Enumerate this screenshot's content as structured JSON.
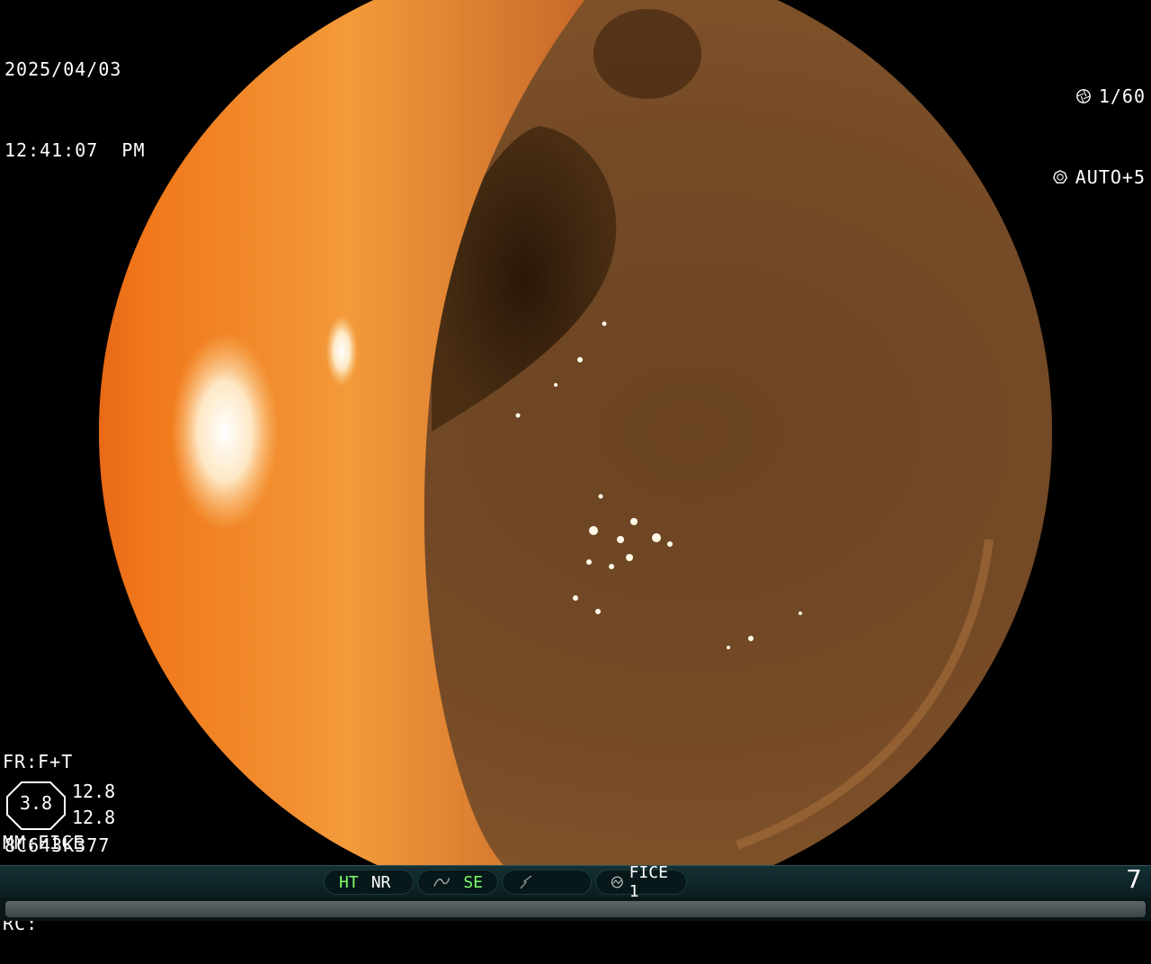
{
  "osd": {
    "date": "2025/04/03",
    "time": "12:41:07  PM",
    "shutter": "1/60",
    "iris": "AUTO+5",
    "fr": "FR:F+T",
    "mm": "MM:FICE",
    "rc": "RC:",
    "zoom_value": "3.8",
    "zoom_side_1": "12.8",
    "zoom_side_2": "12.8",
    "serial": "8C643K377"
  },
  "status_bar": {
    "ht": "HT",
    "nr": "NR",
    "se": "SE",
    "fice": "FICE 1",
    "channel": "7",
    "active_color": "#7dff6a"
  },
  "icons": {
    "shutter": "shutter-icon",
    "iris": "iris-icon",
    "se": "se-icon",
    "fice_mode": "fice-mode-icon",
    "fice": "fice-icon"
  }
}
